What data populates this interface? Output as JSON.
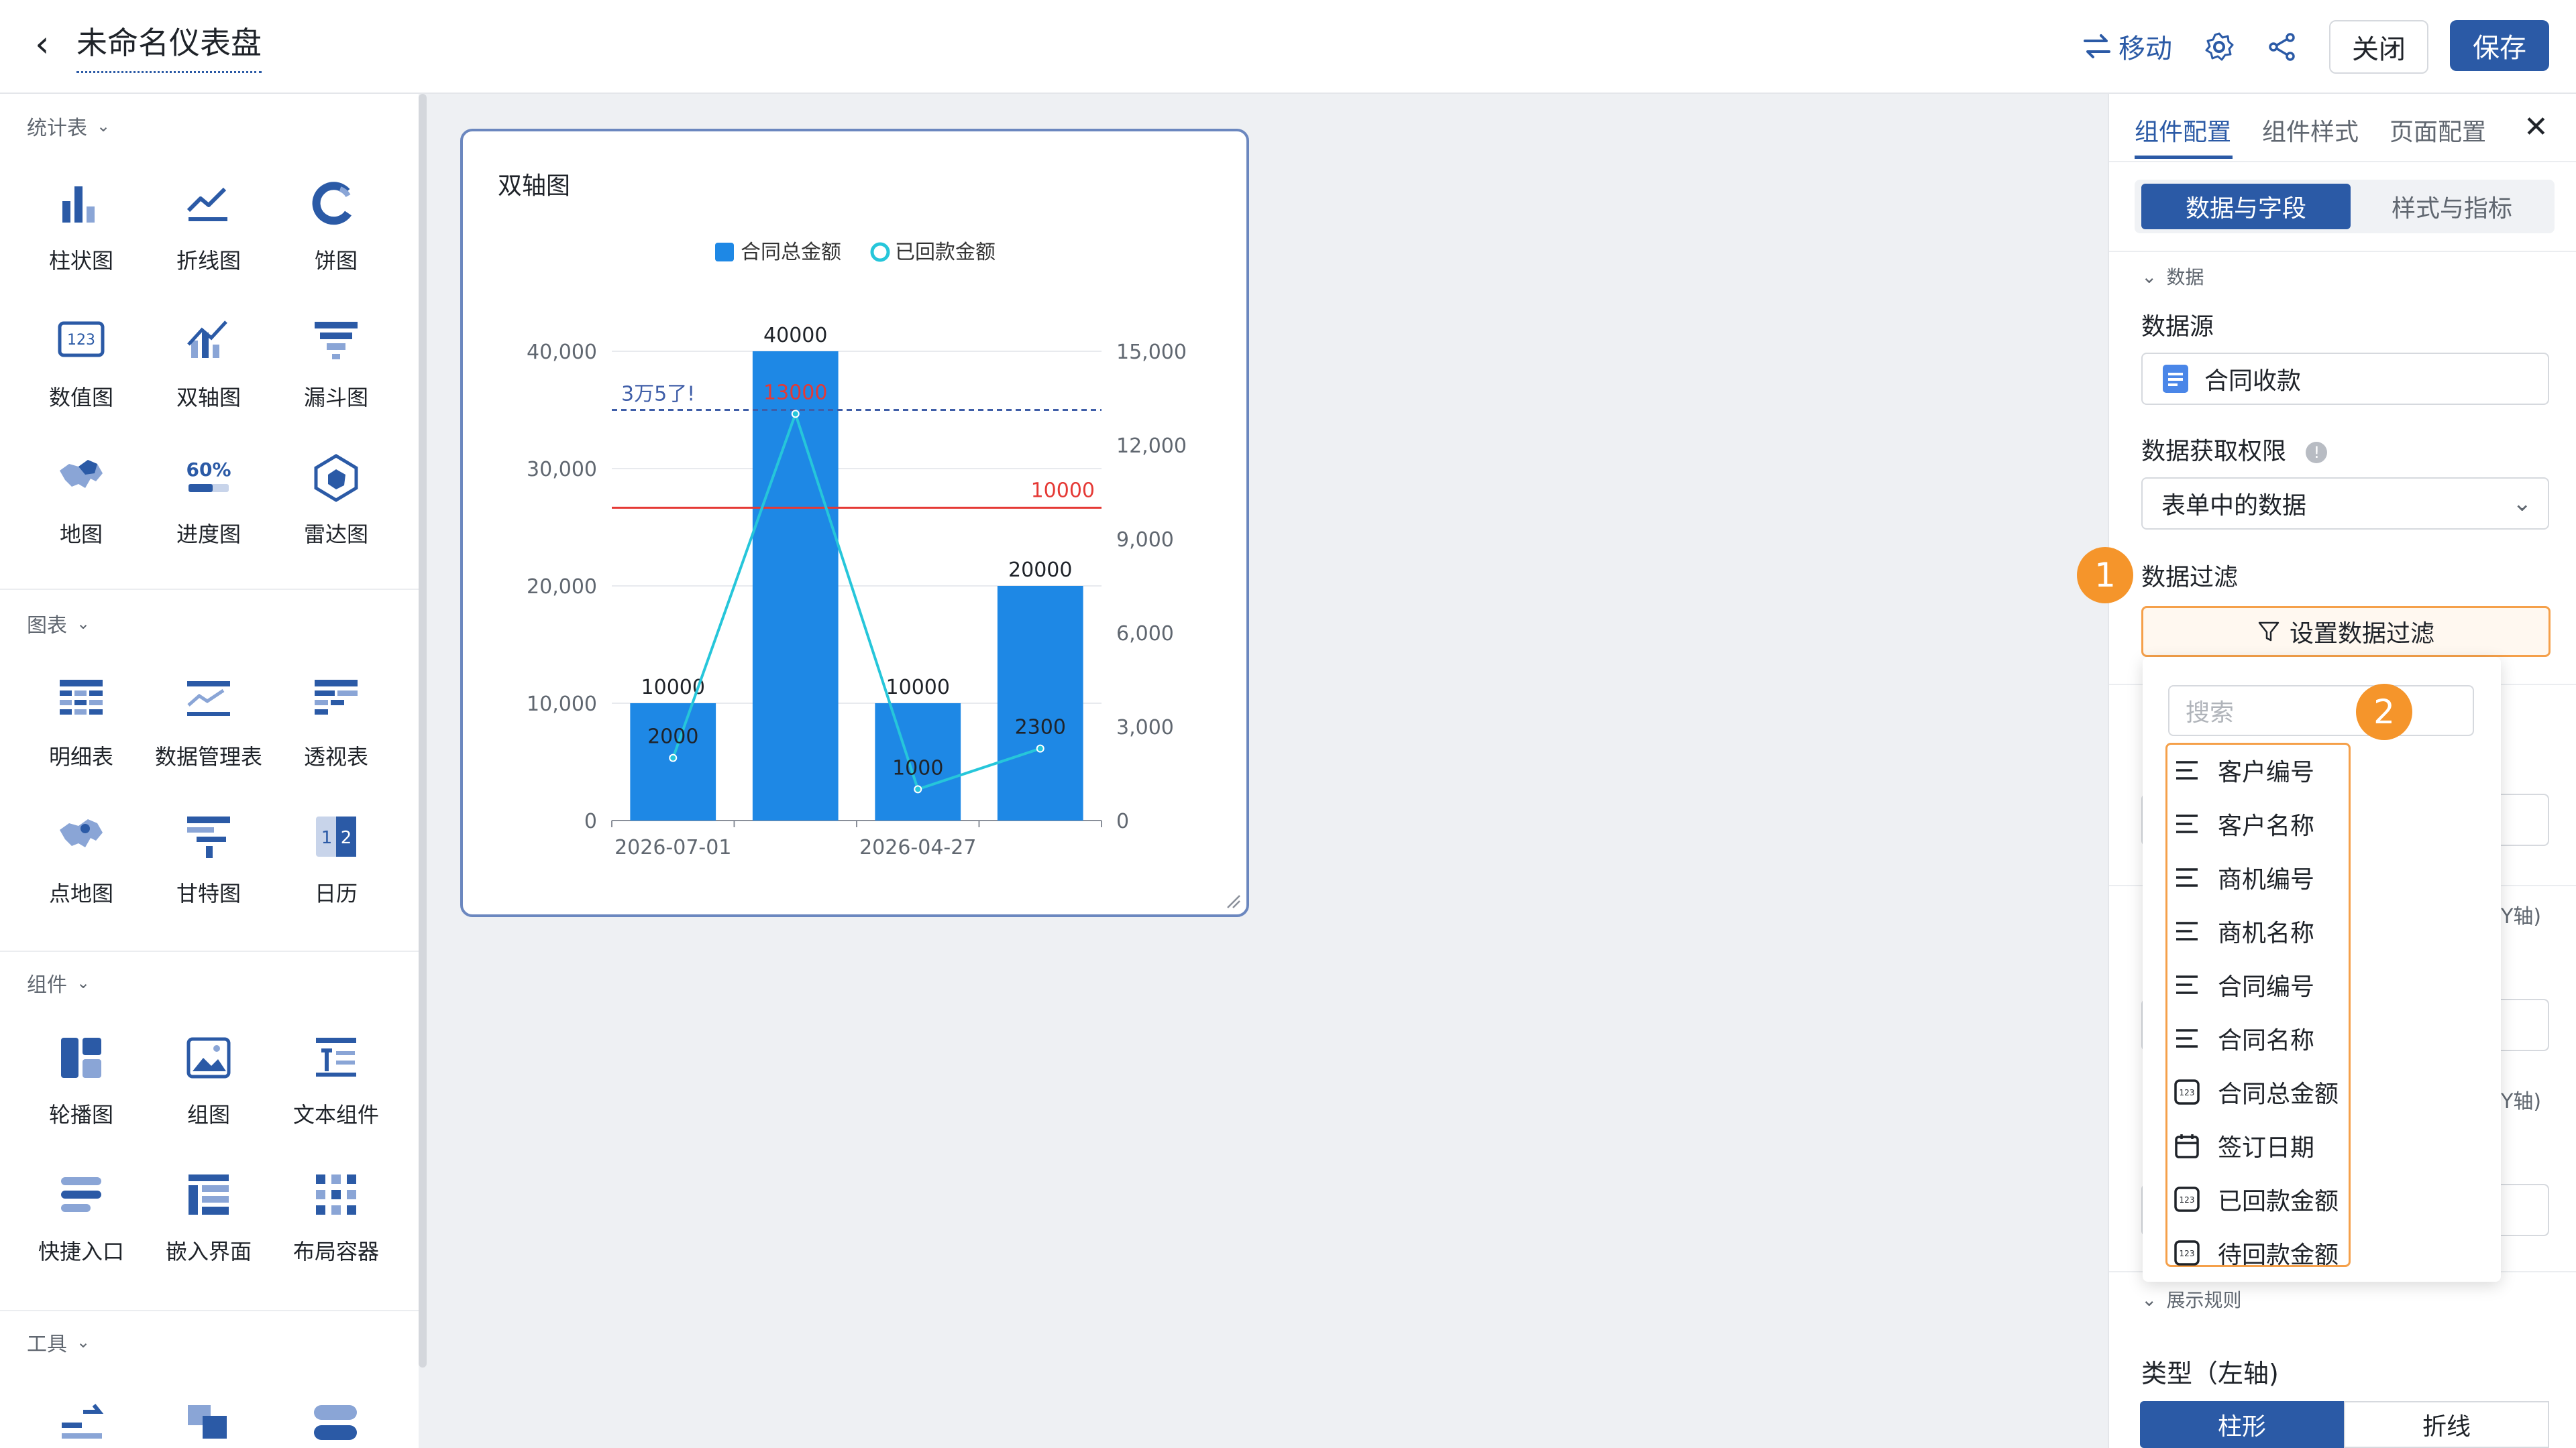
{
  "header": {
    "back_icon": "chevron-left-icon",
    "title": "未命名仪表盘",
    "move_label": "移动",
    "close_label": "关闭",
    "save_label": "保存",
    "accent_color": "#2b5aa6"
  },
  "sidebar": {
    "sections": [
      {
        "title": "统计表",
        "items": [
          {
            "label": "柱状图",
            "icon": "bar-chart-icon"
          },
          {
            "label": "折线图",
            "icon": "line-chart-icon"
          },
          {
            "label": "饼图",
            "icon": "pie-chart-icon"
          },
          {
            "label": "数值图",
            "icon": "number-icon"
          },
          {
            "label": "双轴图",
            "icon": "dual-axis-icon"
          },
          {
            "label": "漏斗图",
            "icon": "funnel-icon"
          },
          {
            "label": "地图",
            "icon": "map-icon"
          },
          {
            "label": "进度图",
            "icon": "progress-icon"
          },
          {
            "label": "雷达图",
            "icon": "radar-icon"
          }
        ]
      },
      {
        "title": "图表",
        "items": [
          {
            "label": "明细表",
            "icon": "detail-table-icon"
          },
          {
            "label": "数据管理表",
            "icon": "data-table-icon"
          },
          {
            "label": "透视表",
            "icon": "pivot-table-icon"
          },
          {
            "label": "点地图",
            "icon": "point-map-icon"
          },
          {
            "label": "甘特图",
            "icon": "gantt-icon"
          },
          {
            "label": "日历",
            "icon": "calendar-icon"
          }
        ]
      },
      {
        "title": "组件",
        "items": [
          {
            "label": "轮播图",
            "icon": "carousel-icon"
          },
          {
            "label": "组图",
            "icon": "image-group-icon"
          },
          {
            "label": "文本组件",
            "icon": "text-icon"
          },
          {
            "label": "快捷入口",
            "icon": "shortcut-icon"
          },
          {
            "label": "嵌入界面",
            "icon": "embed-icon"
          },
          {
            "label": "布局容器",
            "icon": "layout-icon"
          }
        ]
      },
      {
        "title": "工具",
        "items": []
      }
    ]
  },
  "widget": {
    "title": "双轴图"
  },
  "chart_data": {
    "type": "bar",
    "title": "双轴图",
    "legend": [
      {
        "name": "合同总金额",
        "marker": "square",
        "color": "#1e88e5"
      },
      {
        "name": "已回款金额",
        "marker": "circle",
        "color": "#26c6da"
      }
    ],
    "legend_position": "top",
    "categories": [
      "2026-07-01",
      "",
      "2026-04-27",
      ""
    ],
    "x_tick_labels": [
      "2026-07-01",
      "2026-04-27"
    ],
    "series": [
      {
        "name": "合同总金额",
        "type": "bar",
        "axis": "left",
        "values": [
          10000,
          40000,
          10000,
          20000
        ],
        "labels": [
          "10000",
          "40000",
          "10000",
          "20000"
        ],
        "color": "#1e88e5"
      },
      {
        "name": "已回款金额",
        "type": "line",
        "axis": "right",
        "values": [
          2000,
          13000,
          1000,
          2300
        ],
        "labels": [
          "2000",
          "13000",
          "1000",
          "2300"
        ],
        "color": "#26c6da"
      }
    ],
    "y_left": {
      "ticks": [
        "0",
        "10,000",
        "20,000",
        "30,000",
        "40,000"
      ],
      "min": 0,
      "max": 40000
    },
    "y_right": {
      "ticks": [
        "0",
        "3,000",
        "6,000",
        "9,000",
        "12,000",
        "15,000"
      ],
      "min": 0,
      "max": 15000
    },
    "reference_lines": [
      {
        "label": "3万5了!",
        "value": 35000,
        "axis": "left",
        "style": "dashed",
        "color": "#3f5ea8"
      },
      {
        "label": "10000",
        "value": 10000,
        "axis": "right",
        "style": "solid",
        "color": "#e53935"
      }
    ],
    "grid": true
  },
  "right_panel": {
    "tabs": [
      "组件配置",
      "组件样式",
      "页面配置"
    ],
    "segments": [
      "数据与字段",
      "样式与指标"
    ],
    "group_data": "数据",
    "datasource_label": "数据源",
    "datasource_value": "合同收款",
    "permission_label": "数据获取权限",
    "permission_value": "表单中的数据",
    "filter_label": "数据过滤",
    "filter_button": "设置数据过滤",
    "axis_hint_1": "Y轴)",
    "axis_hint_2": "Y轴)",
    "group_display": "展示规则",
    "type_label": "类型（左轴)",
    "type_options": [
      "柱形",
      "折线"
    ]
  },
  "dropdown": {
    "search_placeholder": "搜索",
    "items": [
      {
        "label": "客户编号",
        "icon": "text-field-icon"
      },
      {
        "label": "客户名称",
        "icon": "text-field-icon"
      },
      {
        "label": "商机编号",
        "icon": "text-field-icon"
      },
      {
        "label": "商机名称",
        "icon": "text-field-icon"
      },
      {
        "label": "合同编号",
        "icon": "text-field-icon"
      },
      {
        "label": "合同名称",
        "icon": "text-field-icon"
      },
      {
        "label": "合同总金额",
        "icon": "number-field-icon"
      },
      {
        "label": "签订日期",
        "icon": "date-field-icon"
      },
      {
        "label": "已回款金额",
        "icon": "number-field-icon"
      },
      {
        "label": "待回款金额",
        "icon": "number-field-icon"
      }
    ]
  },
  "annotations": {
    "badge_1": "1",
    "badge_2": "2",
    "badge_color": "#f5952b"
  }
}
